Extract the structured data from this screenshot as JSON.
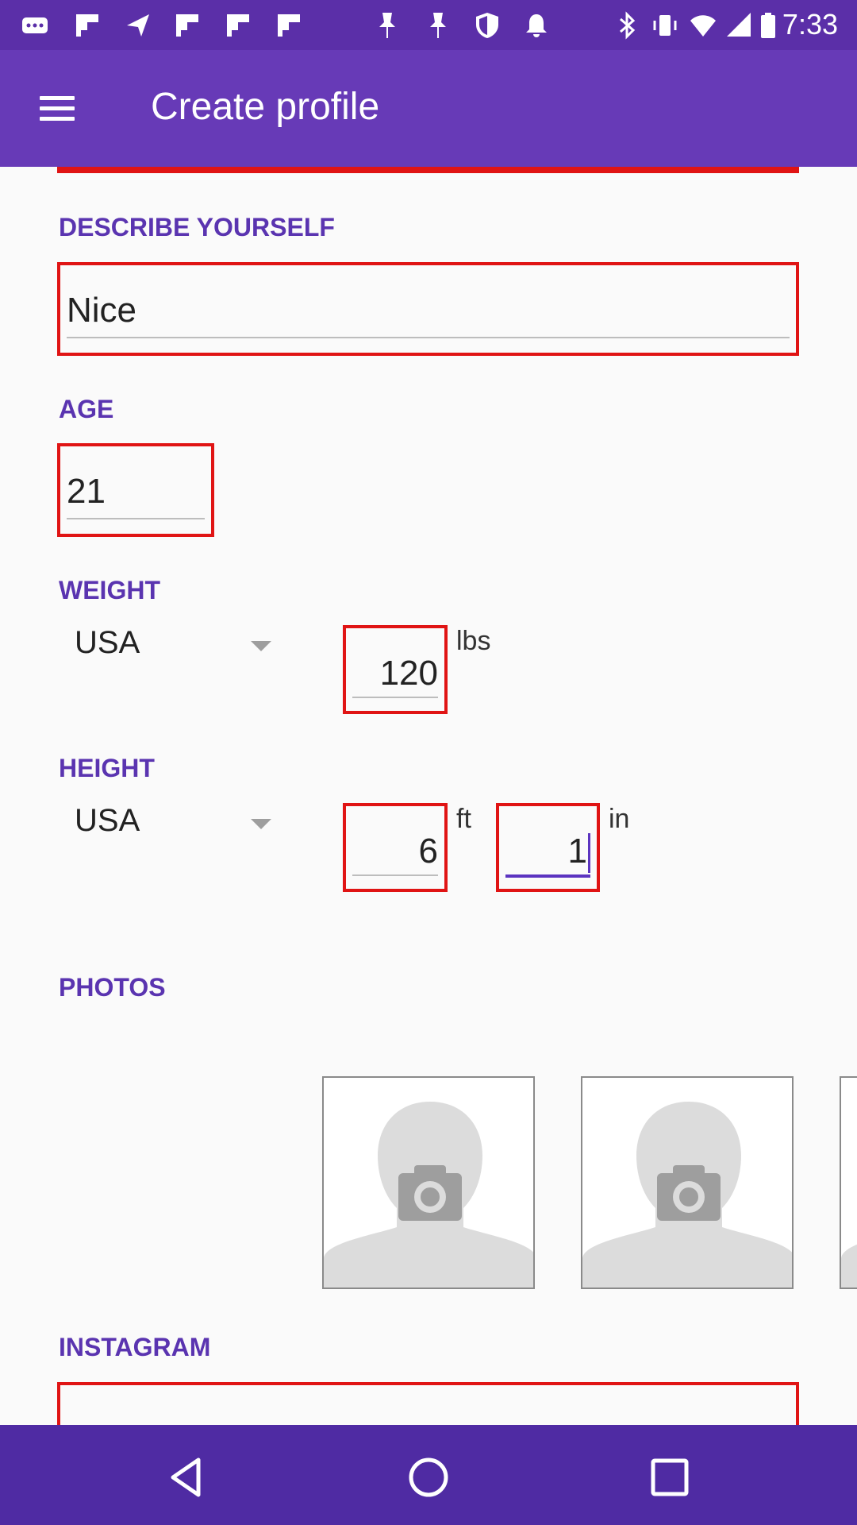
{
  "status_bar": {
    "time": "7:33",
    "icons": [
      "more-notifications-icon",
      "flipboard-icon",
      "send-icon",
      "flipboard-icon",
      "flipboard-icon",
      "flipboard-icon",
      "pin-icon",
      "pin-icon",
      "shield-icon",
      "bell-icon",
      "bluetooth-icon",
      "vibrate-icon",
      "wifi-icon",
      "signal-icon",
      "battery-icon"
    ]
  },
  "app_bar": {
    "title": "Create profile",
    "menu_icon": "menu-icon"
  },
  "form": {
    "describe": {
      "label": "DESCRIBE YOURSELF",
      "value": "Nice"
    },
    "age": {
      "label": "AGE",
      "value": "21"
    },
    "weight": {
      "label": "WEIGHT",
      "unit_system": "USA",
      "value": "120",
      "unit": "lbs"
    },
    "height": {
      "label": "HEIGHT",
      "unit_system": "USA",
      "feet": "6",
      "feet_unit": "ft",
      "inches": "1",
      "inches_unit": "in"
    },
    "photos": {
      "label": "PHOTOS",
      "placeholder_icon": "camera-icon"
    },
    "instagram": {
      "label": "INSTAGRAM",
      "value": ""
    }
  },
  "nav_bar": {
    "back_icon": "back-icon",
    "home_icon": "home-icon",
    "recents_icon": "recents-icon"
  },
  "colors": {
    "status_bar": "#5b2fa8",
    "app_bar": "#673ab7",
    "label": "#5a34b0",
    "highlight": "#e01414",
    "nav_bar": "#4f2ba3"
  }
}
